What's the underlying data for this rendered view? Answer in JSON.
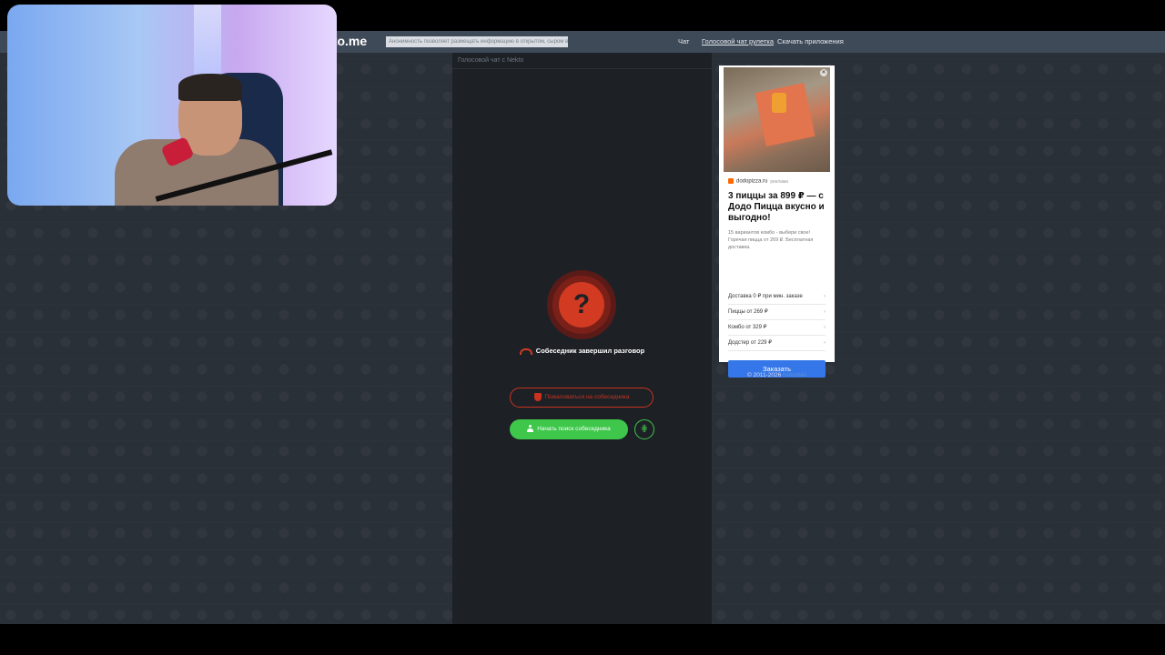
{
  "site": {
    "logo": "kto.me",
    "notice": "Анонимность позволяет размещать информацию в открытом, сыром виде!",
    "nav": [
      {
        "label": "Чат"
      },
      {
        "label": "Голосовой чат рулетка"
      },
      {
        "label": "Скачать приложения"
      }
    ]
  },
  "chat": {
    "header": "Голосовой чат с Nekto",
    "question_glyph": "?",
    "status": "Собеседник завершил разговор",
    "report_label": "Пожаловаться на собеседника",
    "search_label": "Начать поиск собеседника",
    "settings_glyph": "⋕"
  },
  "ad": {
    "source": "dodopizza.ru",
    "source_tag": "реклама",
    "title": "3 пиццы за 899 ₽ — с Додо Пицца вкусно и выгодно!",
    "description": "15 вариантов комбо - выбери свое! Горячая пицца от 269 ₽. Бесплатная доставка.",
    "rows": [
      {
        "label": "Доставка 0 ₽ при мин. заказе"
      },
      {
        "label": "Пиццы от 269 ₽"
      },
      {
        "label": "Комбо от 329 ₽"
      },
      {
        "label": "Додстер от 229 ₽"
      }
    ],
    "order_label": "Заказать",
    "close_glyph": "✕",
    "chevron": "›"
  },
  "footer": {
    "copyright": "© 2011-2026",
    "link": "NektoMe"
  }
}
